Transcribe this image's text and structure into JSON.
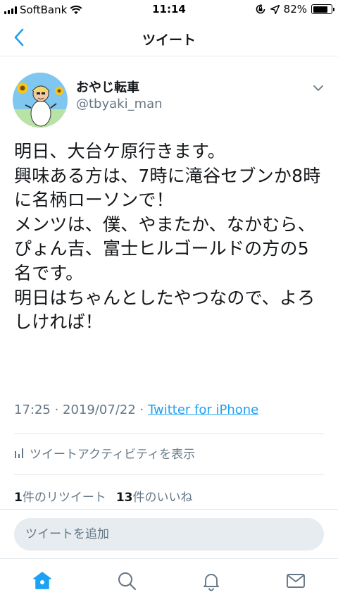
{
  "status_bar": {
    "carrier": "SoftBank",
    "time": "11:14",
    "battery_percent": "82%",
    "battery_level": 0.82
  },
  "nav": {
    "title": "ツイート",
    "back_icon": "chevron-left-icon"
  },
  "tweet": {
    "author": {
      "display_name": "おやじ転車",
      "handle": "@tbyaki_man"
    },
    "text": "明日、大台ケ原行きます。\n興味ある方は、7時に滝谷セブンか8時に名柄ローソンで！\nメンツは、僕、やまたか、なかむら、ぴょん吉、富士ヒルゴールドの方の5名です。\n明日はちゃんとしたやつなので、よろしければ！",
    "time": "17:25",
    "date": "2019/07/22",
    "separator": " · ",
    "client": "Twitter for iPhone",
    "activity_label": "ツイートアクティビティを表示",
    "retweet_count": "1",
    "retweet_label": "件のリツイート",
    "like_count": "13",
    "like_label": "件のいいね"
  },
  "reply": {
    "placeholder": "ツイートを追加"
  },
  "colors": {
    "accent": "#1da1f2",
    "active_tab": "#1da1f2",
    "secondary_text": "#657786"
  },
  "tabs": [
    {
      "icon": "home-icon",
      "active": true
    },
    {
      "icon": "search-icon",
      "active": false
    },
    {
      "icon": "bell-icon",
      "active": false
    },
    {
      "icon": "mail-icon",
      "active": false
    }
  ]
}
